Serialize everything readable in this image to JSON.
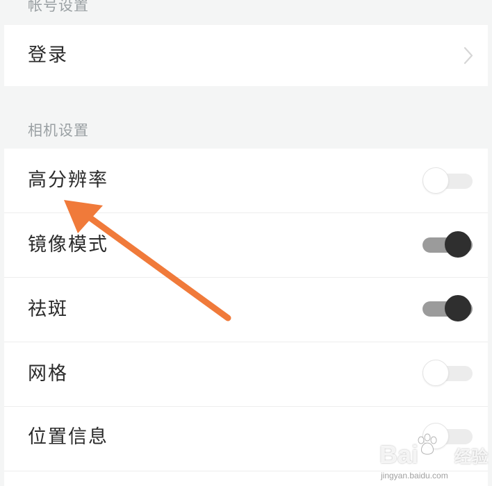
{
  "sections": {
    "account": {
      "header": "帐号设置"
    },
    "camera": {
      "header": "相机设置"
    }
  },
  "account_rows": [
    {
      "label": "登录"
    }
  ],
  "camera_rows": [
    {
      "label": "高分辨率",
      "toggle": false
    },
    {
      "label": "镜像模式",
      "toggle": true
    },
    {
      "label": "祛斑",
      "toggle": true
    },
    {
      "label": "网格",
      "toggle": false
    },
    {
      "label": "位置信息",
      "toggle": false
    }
  ],
  "colors": {
    "background": "#f4f5f5",
    "row": "#ffffff",
    "arrow": "#f07a3a",
    "toggle_on_knob": "#2f2f2f",
    "toggle_on_track": "#9b9b9b",
    "toggle_off_track": "#ececec"
  },
  "watermark": {
    "brand": "Bai",
    "suffix": "经验",
    "url": "jingyan.baidu.com"
  }
}
